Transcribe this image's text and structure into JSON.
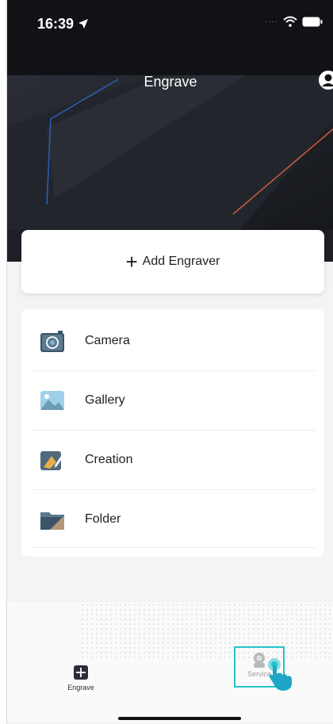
{
  "status_bar": {
    "time": "16:39"
  },
  "nav": {
    "title": "Engrave"
  },
  "add_engraver": {
    "label": "Add Engraver"
  },
  "menu": [
    {
      "label": "Camera",
      "icon": "camera-icon"
    },
    {
      "label": "Gallery",
      "icon": "gallery-icon"
    },
    {
      "label": "Creation",
      "icon": "creation-icon"
    },
    {
      "label": "Folder",
      "icon": "folder-icon"
    }
  ],
  "tabs": [
    {
      "label": "Engrave",
      "icon": "engrave-tab-icon"
    },
    {
      "label": "Service",
      "icon": "service-tab-icon"
    }
  ],
  "colors": {
    "header_bg": "#1a1c22",
    "highlight": "#25c3c9",
    "accent_orange": "#e0623a",
    "accent_blue": "#2e6fd8"
  }
}
